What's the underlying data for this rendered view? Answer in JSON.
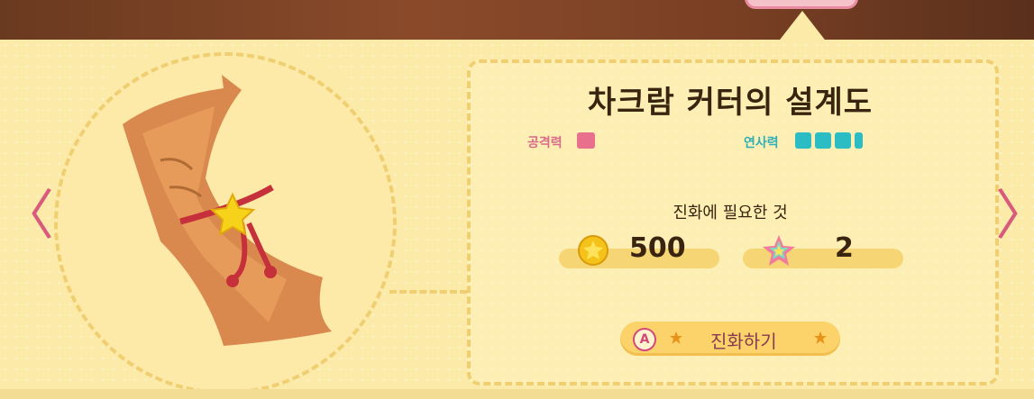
{
  "item": {
    "title": "차크람 커터의 설계도"
  },
  "stats": {
    "attack": {
      "label": "공격력",
      "level": 1,
      "max": 4
    },
    "rapid_fire": {
      "label": "연사력",
      "level": 3.5,
      "max": 4
    }
  },
  "evolution": {
    "heading": "진화에 필요한 것",
    "coins": "500",
    "rainbow_stars": "2",
    "button_key": "A",
    "button_label": "진화하기"
  },
  "navigation": {
    "prev_glyph": "〈",
    "next_glyph": "〉"
  },
  "colors": {
    "attack": "#e8708c",
    "rapid_fire": "#2cbcc4",
    "accent": "#d85a7c",
    "background": "#fbeaa8"
  }
}
